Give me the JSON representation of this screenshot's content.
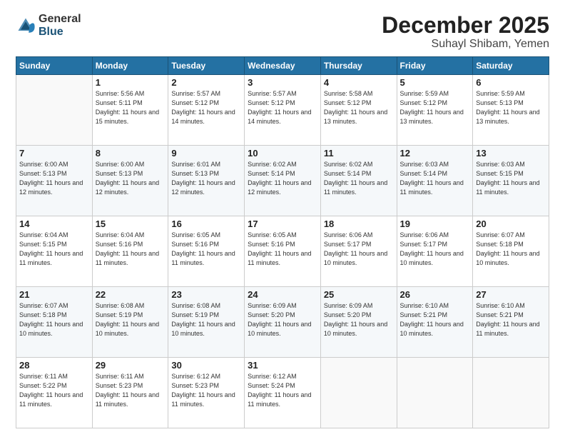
{
  "logo": {
    "general": "General",
    "blue": "Blue"
  },
  "header": {
    "month": "December 2025",
    "location": "Suhayl Shibam, Yemen"
  },
  "weekdays": [
    "Sunday",
    "Monday",
    "Tuesday",
    "Wednesday",
    "Thursday",
    "Friday",
    "Saturday"
  ],
  "weeks": [
    [
      {
        "day": "",
        "sunrise": "",
        "sunset": "",
        "daylight": ""
      },
      {
        "day": "1",
        "sunrise": "Sunrise: 5:56 AM",
        "sunset": "Sunset: 5:11 PM",
        "daylight": "Daylight: 11 hours and 15 minutes."
      },
      {
        "day": "2",
        "sunrise": "Sunrise: 5:57 AM",
        "sunset": "Sunset: 5:12 PM",
        "daylight": "Daylight: 11 hours and 14 minutes."
      },
      {
        "day": "3",
        "sunrise": "Sunrise: 5:57 AM",
        "sunset": "Sunset: 5:12 PM",
        "daylight": "Daylight: 11 hours and 14 minutes."
      },
      {
        "day": "4",
        "sunrise": "Sunrise: 5:58 AM",
        "sunset": "Sunset: 5:12 PM",
        "daylight": "Daylight: 11 hours and 13 minutes."
      },
      {
        "day": "5",
        "sunrise": "Sunrise: 5:59 AM",
        "sunset": "Sunset: 5:12 PM",
        "daylight": "Daylight: 11 hours and 13 minutes."
      },
      {
        "day": "6",
        "sunrise": "Sunrise: 5:59 AM",
        "sunset": "Sunset: 5:13 PM",
        "daylight": "Daylight: 11 hours and 13 minutes."
      }
    ],
    [
      {
        "day": "7",
        "sunrise": "Sunrise: 6:00 AM",
        "sunset": "Sunset: 5:13 PM",
        "daylight": "Daylight: 11 hours and 12 minutes."
      },
      {
        "day": "8",
        "sunrise": "Sunrise: 6:00 AM",
        "sunset": "Sunset: 5:13 PM",
        "daylight": "Daylight: 11 hours and 12 minutes."
      },
      {
        "day": "9",
        "sunrise": "Sunrise: 6:01 AM",
        "sunset": "Sunset: 5:13 PM",
        "daylight": "Daylight: 11 hours and 12 minutes."
      },
      {
        "day": "10",
        "sunrise": "Sunrise: 6:02 AM",
        "sunset": "Sunset: 5:14 PM",
        "daylight": "Daylight: 11 hours and 12 minutes."
      },
      {
        "day": "11",
        "sunrise": "Sunrise: 6:02 AM",
        "sunset": "Sunset: 5:14 PM",
        "daylight": "Daylight: 11 hours and 11 minutes."
      },
      {
        "day": "12",
        "sunrise": "Sunrise: 6:03 AM",
        "sunset": "Sunset: 5:14 PM",
        "daylight": "Daylight: 11 hours and 11 minutes."
      },
      {
        "day": "13",
        "sunrise": "Sunrise: 6:03 AM",
        "sunset": "Sunset: 5:15 PM",
        "daylight": "Daylight: 11 hours and 11 minutes."
      }
    ],
    [
      {
        "day": "14",
        "sunrise": "Sunrise: 6:04 AM",
        "sunset": "Sunset: 5:15 PM",
        "daylight": "Daylight: 11 hours and 11 minutes."
      },
      {
        "day": "15",
        "sunrise": "Sunrise: 6:04 AM",
        "sunset": "Sunset: 5:16 PM",
        "daylight": "Daylight: 11 hours and 11 minutes."
      },
      {
        "day": "16",
        "sunrise": "Sunrise: 6:05 AM",
        "sunset": "Sunset: 5:16 PM",
        "daylight": "Daylight: 11 hours and 11 minutes."
      },
      {
        "day": "17",
        "sunrise": "Sunrise: 6:05 AM",
        "sunset": "Sunset: 5:16 PM",
        "daylight": "Daylight: 11 hours and 11 minutes."
      },
      {
        "day": "18",
        "sunrise": "Sunrise: 6:06 AM",
        "sunset": "Sunset: 5:17 PM",
        "daylight": "Daylight: 11 hours and 10 minutes."
      },
      {
        "day": "19",
        "sunrise": "Sunrise: 6:06 AM",
        "sunset": "Sunset: 5:17 PM",
        "daylight": "Daylight: 11 hours and 10 minutes."
      },
      {
        "day": "20",
        "sunrise": "Sunrise: 6:07 AM",
        "sunset": "Sunset: 5:18 PM",
        "daylight": "Daylight: 11 hours and 10 minutes."
      }
    ],
    [
      {
        "day": "21",
        "sunrise": "Sunrise: 6:07 AM",
        "sunset": "Sunset: 5:18 PM",
        "daylight": "Daylight: 11 hours and 10 minutes."
      },
      {
        "day": "22",
        "sunrise": "Sunrise: 6:08 AM",
        "sunset": "Sunset: 5:19 PM",
        "daylight": "Daylight: 11 hours and 10 minutes."
      },
      {
        "day": "23",
        "sunrise": "Sunrise: 6:08 AM",
        "sunset": "Sunset: 5:19 PM",
        "daylight": "Daylight: 11 hours and 10 minutes."
      },
      {
        "day": "24",
        "sunrise": "Sunrise: 6:09 AM",
        "sunset": "Sunset: 5:20 PM",
        "daylight": "Daylight: 11 hours and 10 minutes."
      },
      {
        "day": "25",
        "sunrise": "Sunrise: 6:09 AM",
        "sunset": "Sunset: 5:20 PM",
        "daylight": "Daylight: 11 hours and 10 minutes."
      },
      {
        "day": "26",
        "sunrise": "Sunrise: 6:10 AM",
        "sunset": "Sunset: 5:21 PM",
        "daylight": "Daylight: 11 hours and 10 minutes."
      },
      {
        "day": "27",
        "sunrise": "Sunrise: 6:10 AM",
        "sunset": "Sunset: 5:21 PM",
        "daylight": "Daylight: 11 hours and 11 minutes."
      }
    ],
    [
      {
        "day": "28",
        "sunrise": "Sunrise: 6:11 AM",
        "sunset": "Sunset: 5:22 PM",
        "daylight": "Daylight: 11 hours and 11 minutes."
      },
      {
        "day": "29",
        "sunrise": "Sunrise: 6:11 AM",
        "sunset": "Sunset: 5:23 PM",
        "daylight": "Daylight: 11 hours and 11 minutes."
      },
      {
        "day": "30",
        "sunrise": "Sunrise: 6:12 AM",
        "sunset": "Sunset: 5:23 PM",
        "daylight": "Daylight: 11 hours and 11 minutes."
      },
      {
        "day": "31",
        "sunrise": "Sunrise: 6:12 AM",
        "sunset": "Sunset: 5:24 PM",
        "daylight": "Daylight: 11 hours and 11 minutes."
      },
      {
        "day": "",
        "sunrise": "",
        "sunset": "",
        "daylight": ""
      },
      {
        "day": "",
        "sunrise": "",
        "sunset": "",
        "daylight": ""
      },
      {
        "day": "",
        "sunrise": "",
        "sunset": "",
        "daylight": ""
      }
    ]
  ]
}
